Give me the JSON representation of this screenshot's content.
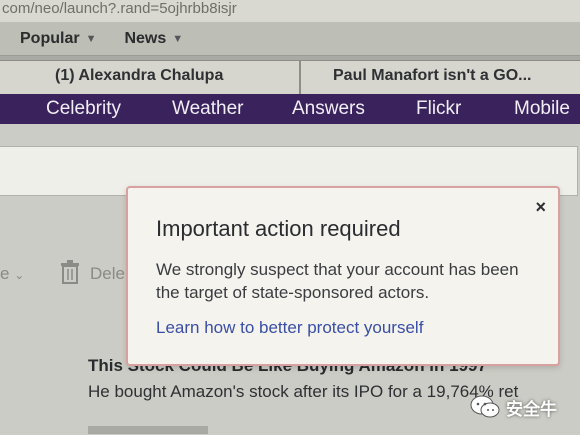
{
  "address_bar": {
    "url_text": "com/neo/launch?.rand=5ojhrbb8isjr"
  },
  "bookmarks": [
    {
      "label": "Popular"
    },
    {
      "label": "News"
    }
  ],
  "tabs": [
    {
      "label": "(1) Alexandra Chalupa"
    },
    {
      "label": "Paul Manafort isn't a GO..."
    }
  ],
  "nav": {
    "items": [
      {
        "label": "Celebrity"
      },
      {
        "label": "Weather"
      },
      {
        "label": "Answers"
      },
      {
        "label": "Flickr"
      },
      {
        "label": "Mobile"
      }
    ]
  },
  "toolbar": {
    "more_label": "e",
    "delete_label": "Dele"
  },
  "email_list": {
    "headline": "This Stock Could Be Like Buying Amazon in 1997",
    "snippet": "He bought Amazon's stock after its IPO for a 19,764% ret"
  },
  "modal": {
    "title": "Important action required",
    "body": "We strongly suspect that your account has been the target of state-sponsored actors.",
    "link": "Learn how to better protect yourself",
    "close_glyph": "×"
  },
  "watermark": {
    "text": "安全牛"
  },
  "colors": {
    "nav_background": "#3a235c",
    "modal_border": "#d8a0a0",
    "link": "#3a4ea6"
  },
  "icons": [
    "chevron-down-icon",
    "trash-icon",
    "close-icon",
    "wechat-icon"
  ]
}
